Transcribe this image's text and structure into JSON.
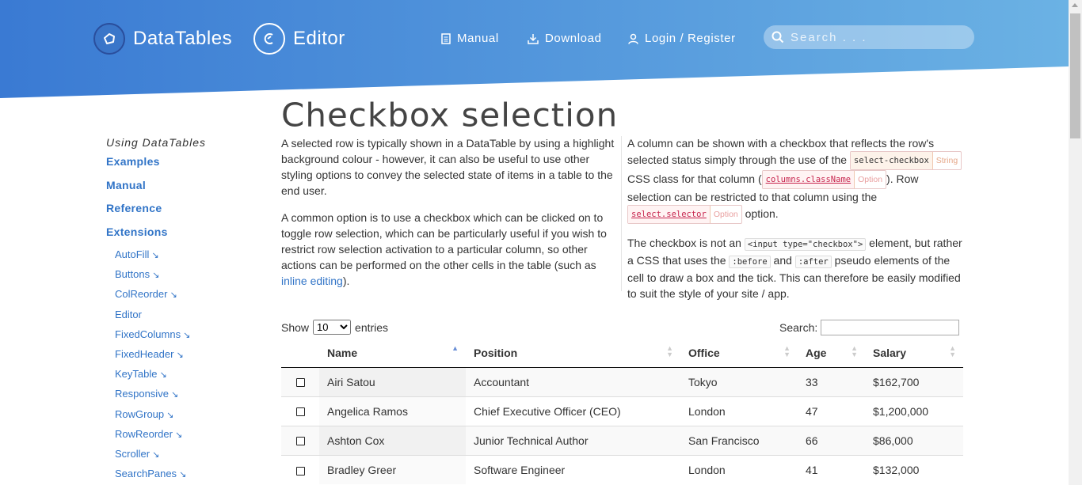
{
  "header": {
    "brand_datatables": "DataTables",
    "brand_editor": "Editor",
    "nav": {
      "manual": "Manual",
      "download": "Download",
      "login": "Login / Register"
    },
    "search_placeholder": "Search . . .",
    "colors": {
      "gradient_start": "#3a7bd5",
      "gradient_end": "#6aaee6"
    }
  },
  "sidebar": {
    "group_title": "Using DataTables",
    "main_links": [
      "Examples",
      "Manual",
      "Reference",
      "Extensions"
    ],
    "extensions": [
      {
        "label": "AutoFill",
        "arrow": "↘"
      },
      {
        "label": "Buttons",
        "arrow": "↘"
      },
      {
        "label": "ColReorder",
        "arrow": "↘"
      },
      {
        "label": "Editor",
        "arrow": ""
      },
      {
        "label": "FixedColumns",
        "arrow": "↘"
      },
      {
        "label": "FixedHeader",
        "arrow": "↘"
      },
      {
        "label": "KeyTable",
        "arrow": "↘"
      },
      {
        "label": "Responsive",
        "arrow": "↘"
      },
      {
        "label": "RowGroup",
        "arrow": "↘"
      },
      {
        "label": "RowReorder",
        "arrow": "↘"
      },
      {
        "label": "Scroller",
        "arrow": "↘"
      },
      {
        "label": "SearchPanes",
        "arrow": "↘"
      }
    ]
  },
  "main": {
    "title": "Checkbox selection",
    "left": {
      "p1": "A selected row is typically shown in a DataTable by using a highlight background colour - however, it can also be useful to use other styling options to convey the selected state of items in a table to the end user.",
      "p2_before": "A common option is to use a checkbox which can be clicked on to toggle row selection, which can be particularly useful if you wish to restrict row selection activation to a particular column, so other actions can be performed on the other cells in the table (such as ",
      "p2_link": "inline editing",
      "p2_after": ")."
    },
    "right": {
      "p1_a": "A column can be shown with a checkbox that reflects the row's selected status simply through the use of the ",
      "tag1_name": "select-checkbox",
      "tag1_type": "String",
      "p1_b": " CSS class for that column (",
      "tag2_name": "columns.className",
      "tag2_type": "Option",
      "p1_c": "). Row selection can be restricted to that column using the ",
      "tag3_name": "select.selector",
      "tag3_type": "Option",
      "p1_d": " option.",
      "p2_a": "The checkbox is not an ",
      "code1": "<input type=\"checkbox\">",
      "p2_b": " element, but rather a CSS that uses the ",
      "code2": ":before",
      "p2_c": " and ",
      "code3": ":after",
      "p2_d": " pseudo elements of the cell to draw a box and the tick. This can therefore be easily modified to suit the style of your site / app."
    }
  },
  "table_controls": {
    "show_label": "Show",
    "length_value": "10",
    "entries_label": "entries",
    "search_label": "Search:"
  },
  "table": {
    "headers": [
      "Name",
      "Position",
      "Office",
      "Age",
      "Salary"
    ],
    "rows": [
      {
        "name": "Airi Satou",
        "position": "Accountant",
        "office": "Tokyo",
        "age": "33",
        "salary": "$162,700"
      },
      {
        "name": "Angelica Ramos",
        "position": "Chief Executive Officer (CEO)",
        "office": "London",
        "age": "47",
        "salary": "$1,200,000"
      },
      {
        "name": "Ashton Cox",
        "position": "Junior Technical Author",
        "office": "San Francisco",
        "age": "66",
        "salary": "$86,000"
      },
      {
        "name": "Bradley Greer",
        "position": "Software Engineer",
        "office": "London",
        "age": "41",
        "salary": "$132,000"
      }
    ]
  }
}
